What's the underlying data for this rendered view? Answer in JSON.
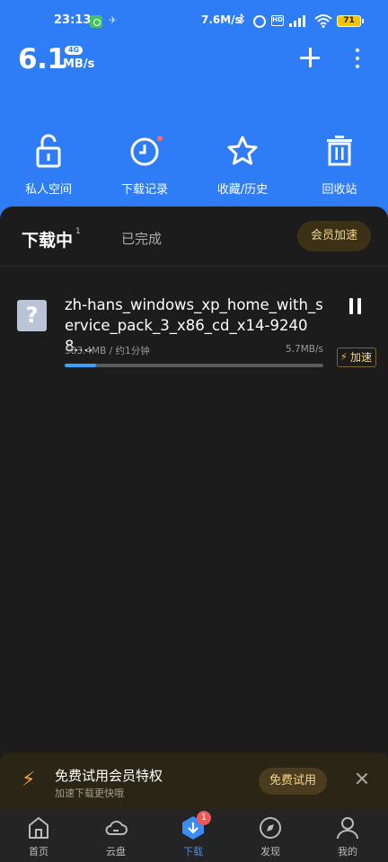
{
  "status_bar": {
    "time": "23:13",
    "net_speed": "7.6M/s",
    "battery": "71"
  },
  "header": {
    "speed_value": "6.1",
    "speed_badge": "4G",
    "speed_unit": "MB/s",
    "quick_actions": [
      {
        "label": "私人空间",
        "icon": "unlock-icon"
      },
      {
        "label": "下载记录",
        "icon": "clock-icon"
      },
      {
        "label": "收藏/历史",
        "icon": "star-icon"
      },
      {
        "label": "回收站",
        "icon": "trash-icon"
      }
    ]
  },
  "tabs": {
    "active": "下载中",
    "active_count": "1",
    "done": "已完成",
    "vip_button": "会员加速"
  },
  "downloads": [
    {
      "name": "zh-hans_windows_xp_home_with_service_pack_3_x86_cd_x14-92408....",
      "size_eta": "583.4MB / 约1分钟",
      "speed": "5.7MB/s",
      "progress": 0.12,
      "accel_label": "加速"
    }
  ],
  "promo": {
    "title": "免费试用会员特权",
    "subtitle": "加速下载更快哦",
    "button": "免费试用"
  },
  "bottom_nav": {
    "items": [
      {
        "label": "首页",
        "icon": "home-icon"
      },
      {
        "label": "云盘",
        "icon": "cloud-icon"
      },
      {
        "label": "下载",
        "icon": "download-icon",
        "badge": "1"
      },
      {
        "label": "发现",
        "icon": "compass-icon"
      },
      {
        "label": "我的",
        "icon": "user-icon"
      }
    ]
  },
  "colors": {
    "header_blue": "#2e7cf6",
    "panel_bg": "#1c1c1c",
    "progress_fill": "#3aa0ff",
    "vip_gold": "#f4d58a",
    "active_nav": "#3a8cf7"
  }
}
